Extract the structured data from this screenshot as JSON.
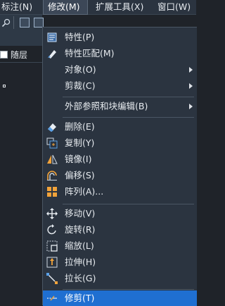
{
  "menubar": {
    "items": [
      {
        "label": "标注(N)"
      },
      {
        "label": "修改(M)"
      },
      {
        "label": "扩展工具(X)"
      },
      {
        "label": "窗口(W)"
      }
    ]
  },
  "toolbar": {
    "layer_name": "随层"
  },
  "menu": {
    "items": [
      {
        "label": "特性(P)",
        "icon": "properties-icon"
      },
      {
        "label": "特性匹配(M)",
        "icon": "match-properties-icon"
      },
      {
        "label": "对象(O)",
        "submenu": true
      },
      {
        "label": "剪裁(C)",
        "submenu": true
      },
      {
        "label": "外部参照和块编辑(B)",
        "submenu": true
      },
      {
        "label": "删除(E)",
        "icon": "eraser-icon"
      },
      {
        "label": "复制(Y)",
        "icon": "copy-icon"
      },
      {
        "label": "镜像(I)",
        "icon": "mirror-icon"
      },
      {
        "label": "偏移(S)",
        "icon": "offset-icon"
      },
      {
        "label": "阵列(A)...",
        "icon": "array-icon"
      },
      {
        "label": "移动(V)",
        "icon": "move-icon"
      },
      {
        "label": "旋转(R)",
        "icon": "rotate-icon"
      },
      {
        "label": "缩放(L)",
        "icon": "scale-icon"
      },
      {
        "label": "拉伸(H)",
        "icon": "stretch-icon"
      },
      {
        "label": "拉长(G)",
        "icon": "lengthen-icon"
      },
      {
        "label": "修剪(T)",
        "icon": "trim-icon"
      }
    ]
  },
  "colors": {
    "menu_bg": "#2b3440",
    "highlight": "#1f6fd1",
    "icon_blue": "#5aa0e6",
    "icon_orange": "#f2a33a"
  }
}
